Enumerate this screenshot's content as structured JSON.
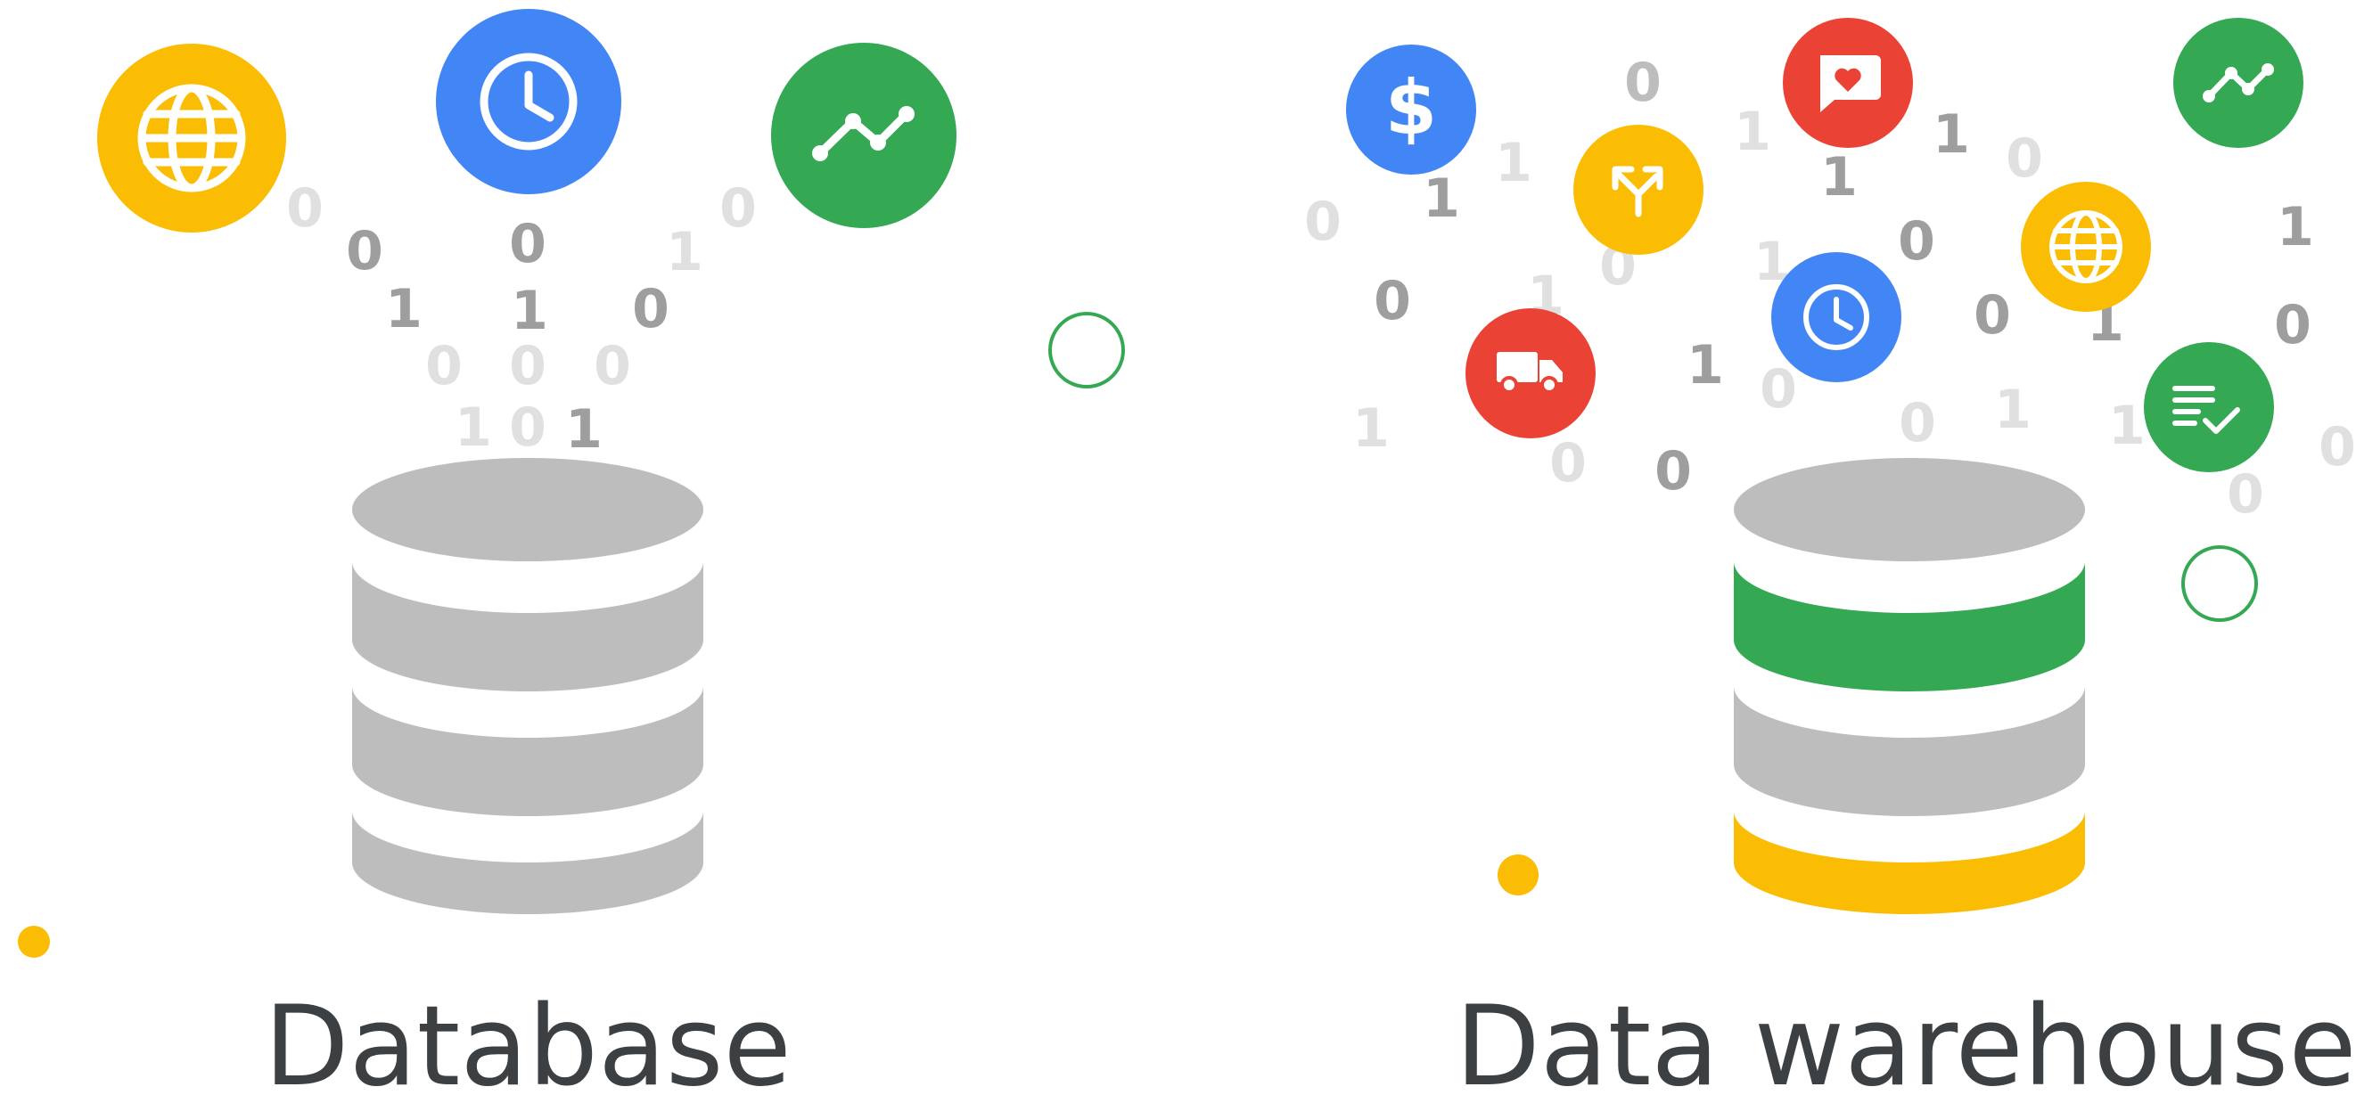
{
  "palette": {
    "green": "#34a853",
    "blue": "#4285f4",
    "yellow": "#fbbc04",
    "red": "#ea4335",
    "cylinder_gray": "#bdbdbd",
    "text": "#3c4043"
  },
  "database": {
    "label": "Database",
    "layer_colors": [
      "gray",
      "gray",
      "gray",
      "gray"
    ],
    "icons": [
      "globe-icon",
      "clock-icon",
      "trend-line-icon"
    ]
  },
  "data_warehouse": {
    "label": "Data warehouse",
    "layer_colors": [
      "gray",
      "green",
      "gray",
      "yellow"
    ],
    "icons": [
      "dollar-icon",
      "chat-heart-icon",
      "trend-line-icon",
      "merge-arrows-icon",
      "globe-icon",
      "clock-icon",
      "truck-icon",
      "checklist-icon"
    ]
  },
  "binary_digits": {
    "zero": "0",
    "one": "1"
  }
}
